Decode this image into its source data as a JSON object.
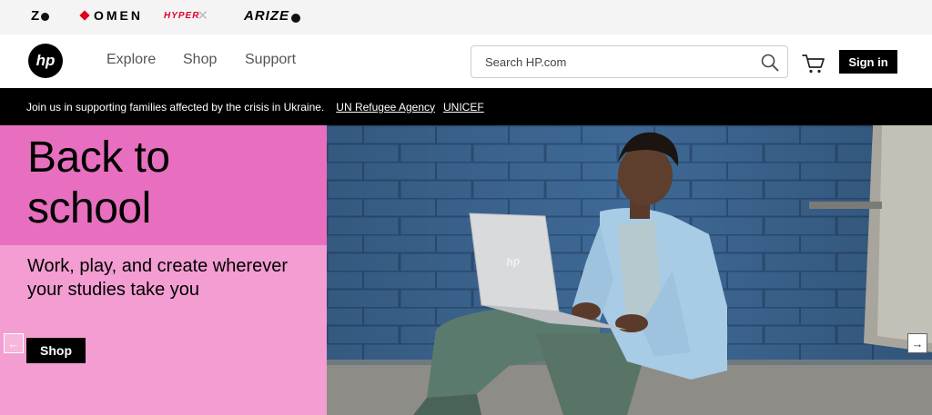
{
  "brands": {
    "z": "Z",
    "omen": "OMEN",
    "hyperx": "HYPER",
    "arize": "ARIZE"
  },
  "header": {
    "logo": "hp",
    "nav": [
      "Explore",
      "Shop",
      "Support"
    ],
    "search_placeholder": "Search HP.com",
    "signin_label": "Sign in"
  },
  "notice": {
    "text": "Join us in supporting families affected by the crisis in Ukraine.",
    "links": [
      "UN Refugee Agency",
      "UNICEF"
    ]
  },
  "hero": {
    "title_line1": "Back to",
    "title_line2": "school",
    "subtitle": "Work, play, and create wherever your studies take you",
    "cta_label": "Shop",
    "prev_arrow": "←",
    "next_arrow": "→",
    "laptop_logo": "hp"
  },
  "colors": {
    "hero_pink_dark": "#e86fbf",
    "hero_pink_light": "#f39dd2",
    "wall_blue": "#3f6a98",
    "brand_red": "#e0001a"
  },
  "icons": {
    "search": "search-icon",
    "cart": "cart-icon",
    "prev": "arrow-left-icon",
    "next": "arrow-right-icon"
  }
}
